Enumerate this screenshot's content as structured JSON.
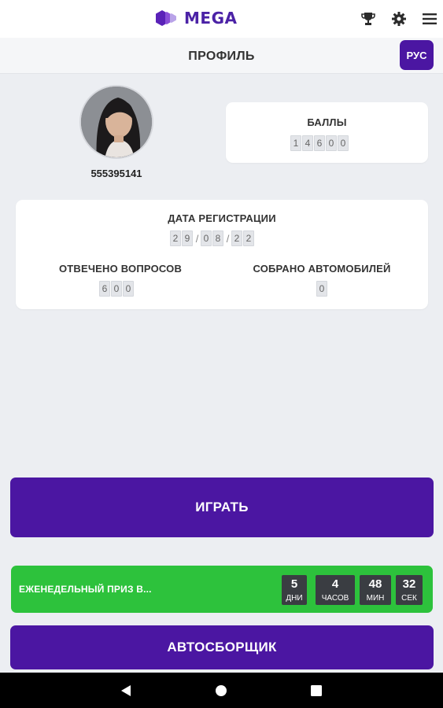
{
  "header": {
    "brand": "MEGA",
    "icons": [
      "trophy-icon",
      "gear-icon",
      "menu-icon"
    ]
  },
  "subheader": {
    "title": "ПРОФИЛЬ",
    "language": "РУС"
  },
  "profile": {
    "user_id": "555395141"
  },
  "points": {
    "label": "БАЛЛЫ",
    "digits": [
      "1",
      "4",
      "6",
      "0",
      "0"
    ]
  },
  "stats": {
    "registration_label": "ДАТА РЕГИСТРАЦИИ",
    "registration_date": [
      "2",
      "9",
      "/",
      "0",
      "8",
      "/",
      "2",
      "2"
    ],
    "answered_label": "ОТВЕЧЕНО ВОПРОСОВ",
    "answered_digits": [
      "6",
      "0",
      "0"
    ],
    "collected_label": "СОБРАНО АВТОМОБИЛЕЙ",
    "collected_digits": [
      "0"
    ]
  },
  "play_button": "ИГРАТЬ",
  "weekly_prize": {
    "text": "ЕЖЕНЕДЕЛЬНЫЙ ПРИЗ В...",
    "timer": [
      {
        "value": "5",
        "unit": "ДНИ"
      },
      {
        "value": "4",
        "unit": "ЧАСОВ"
      },
      {
        "value": "48",
        "unit": "МИН"
      },
      {
        "value": "32",
        "unit": "СЕК"
      }
    ]
  },
  "assembler_button": "АВТОСБОРЩИК",
  "colors": {
    "primary": "#4b16a2",
    "prize": "#2dc23c",
    "timer_box": "#3a3d42",
    "background": "#eceef2"
  }
}
